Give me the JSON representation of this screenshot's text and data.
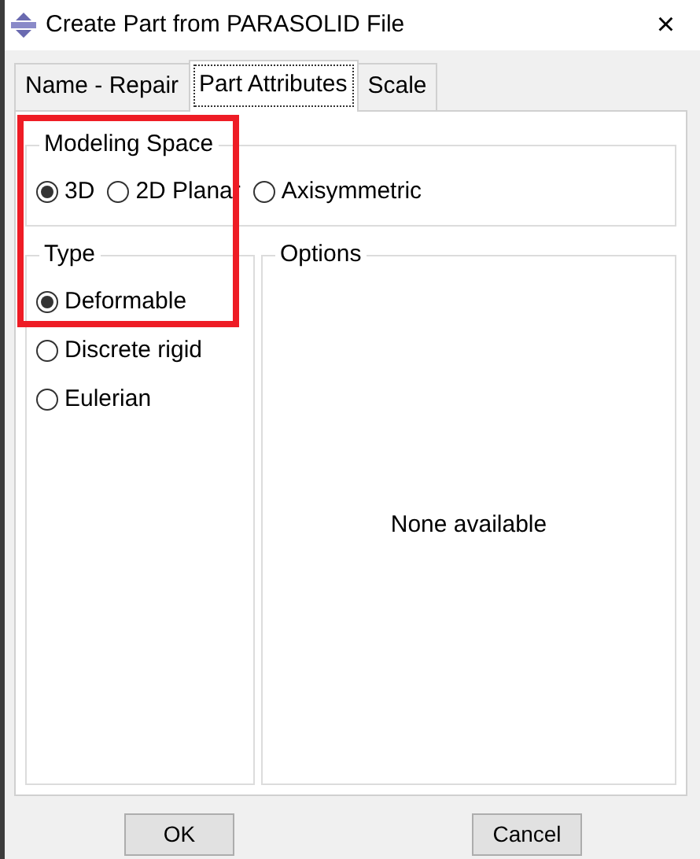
{
  "window": {
    "title": "Create Part from PARASOLID File",
    "close": "×"
  },
  "tabs": [
    {
      "label": "Name - Repair",
      "selected": false
    },
    {
      "label": "Part Attributes",
      "selected": true
    },
    {
      "label": "Scale",
      "selected": false
    }
  ],
  "modeling_space": {
    "title": "Modeling Space",
    "options": [
      {
        "label": "3D",
        "selected": true
      },
      {
        "label": "2D Planar",
        "selected": false
      },
      {
        "label": "Axisymmetric",
        "selected": false
      }
    ]
  },
  "type": {
    "title": "Type",
    "options": [
      {
        "label": "Deformable",
        "selected": true
      },
      {
        "label": "Discrete rigid",
        "selected": false
      },
      {
        "label": "Eulerian",
        "selected": false
      }
    ]
  },
  "options": {
    "title": "Options",
    "message": "None available"
  },
  "annotation": {
    "kind": "highlight",
    "color": "#ee1c25"
  },
  "buttons": [
    "OK",
    "Cancel"
  ]
}
